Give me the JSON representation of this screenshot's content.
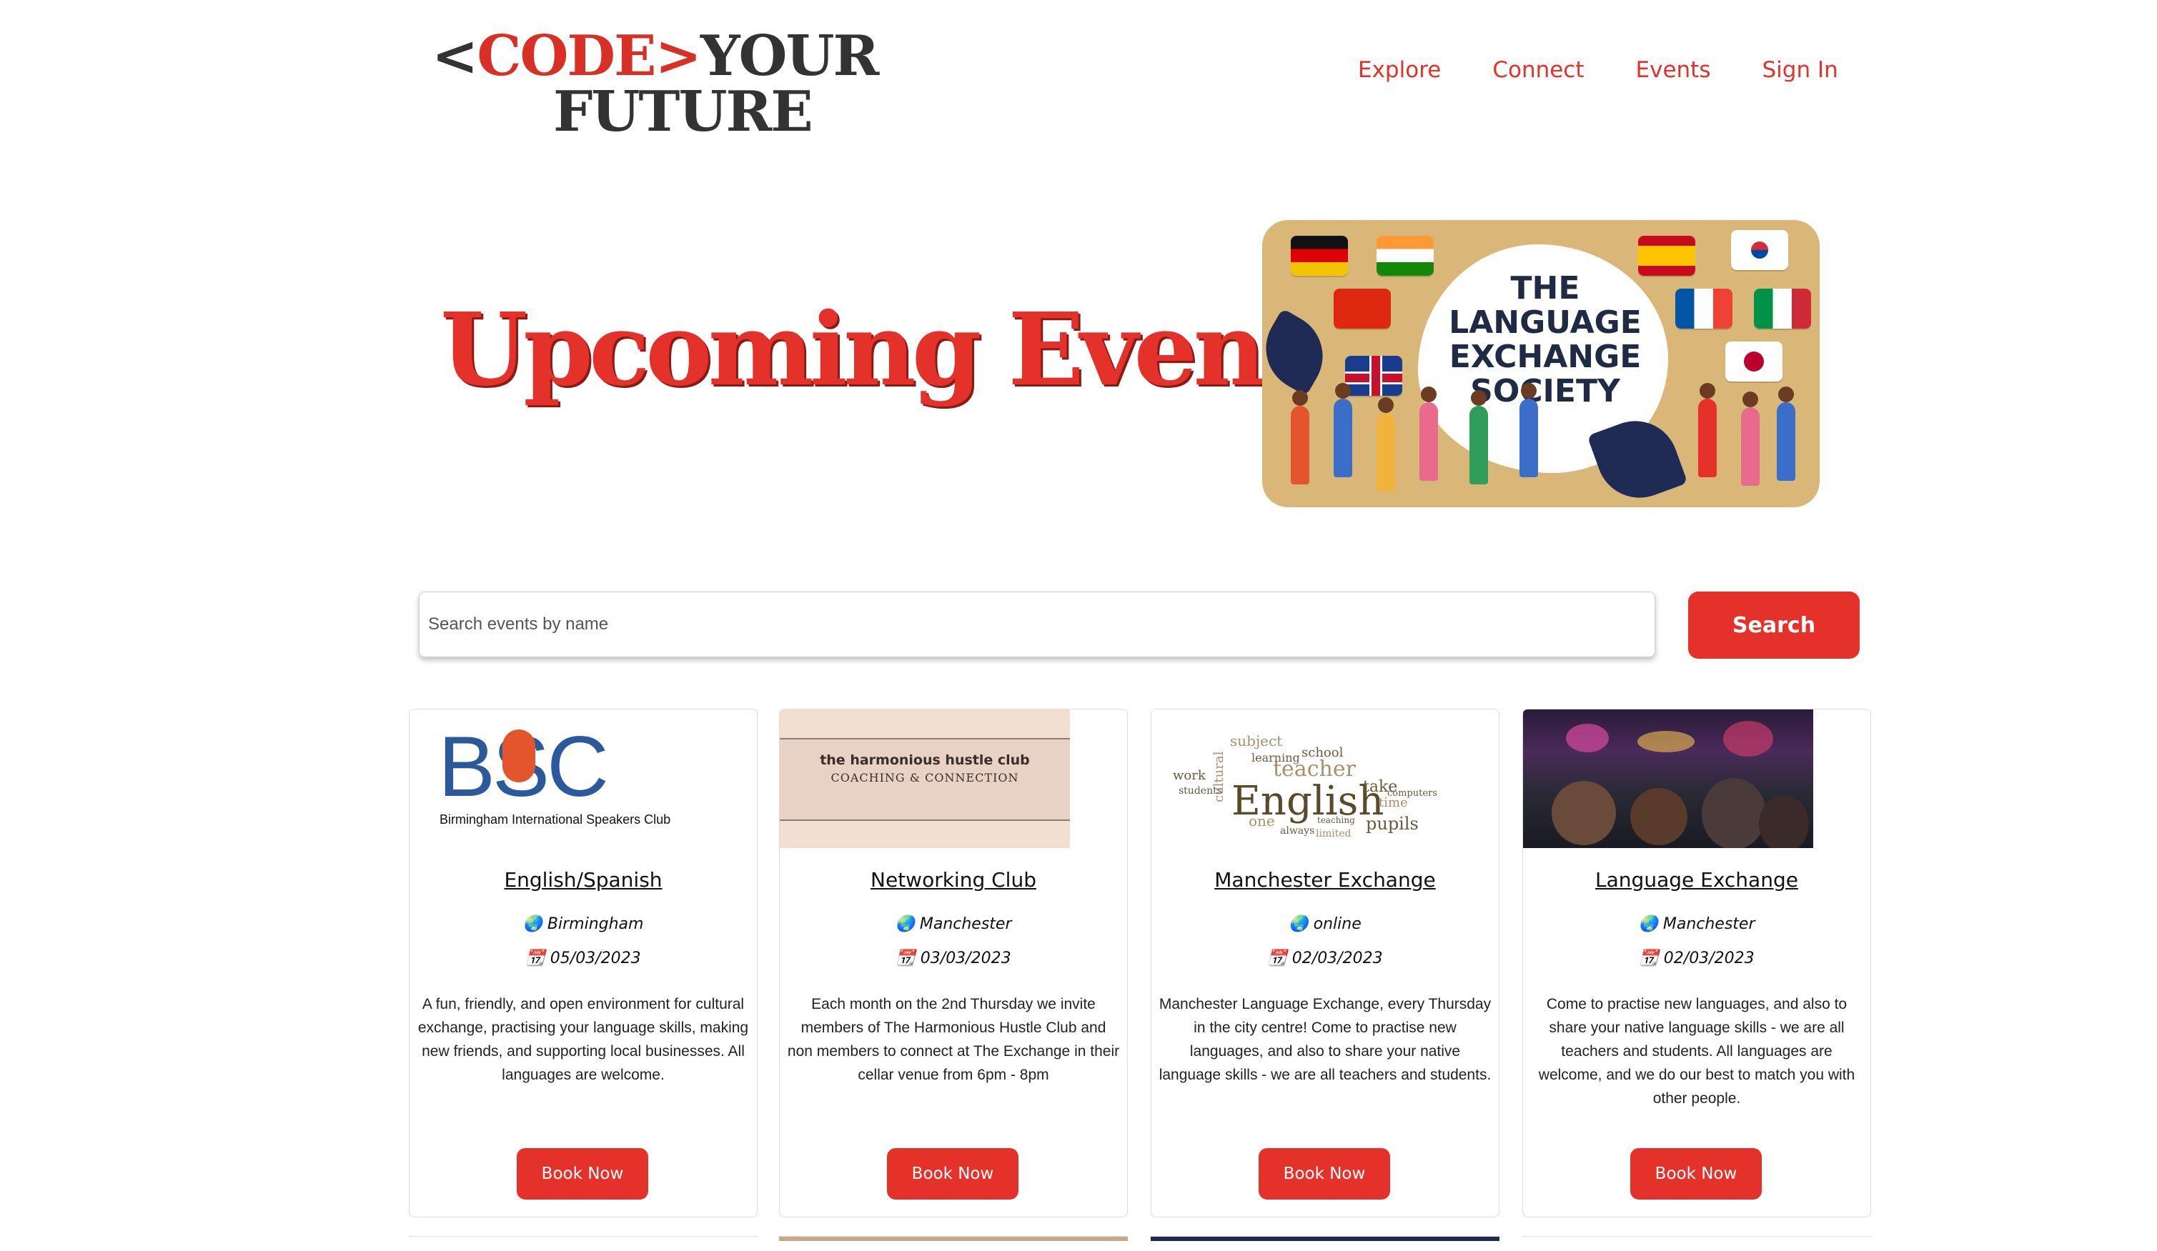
{
  "header": {
    "logo": {
      "line1_bracket_open": "<",
      "line1_code": "CODE",
      "line1_bracket_close": ">",
      "line1_your": "YOUR",
      "line2": "FUTURE"
    },
    "nav": [
      "Explore",
      "Connect",
      "Events",
      "Sign In"
    ]
  },
  "hero": {
    "title": "Upcoming Events",
    "image_text": [
      "THE",
      "LANGUAGE",
      "EXCHANGE",
      "SOCIETY"
    ]
  },
  "search": {
    "placeholder": "Search events by name",
    "button": "Search"
  },
  "events": [
    {
      "title": "English/Spanish",
      "location": "Birmingham",
      "date": "05/03/2023",
      "description": "A fun, friendly, and open environment for cultural exchange, practising your language skills, making new friends, and supporting local businesses. All languages are welcome.",
      "button": "Book Now",
      "image": {
        "logo_text": "BSC",
        "subtitle": "Birmingham International Speakers Club"
      }
    },
    {
      "title": "Networking Club",
      "location": "Manchester",
      "date": "03/03/2023",
      "description": "Each month on the 2nd Thursday we invite members of The Harmonious Hustle Club and non members to connect at The Exchange in their cellar venue from 6pm - 8pm",
      "button": "Book Now",
      "image": {
        "line1": "the harmonious hustle club",
        "line2": "COACHING & CONNECTION"
      }
    },
    {
      "title": "Manchester Exchange",
      "location": "online",
      "date": "02/03/2023",
      "description": "Manchester Language Exchange, every Thursday in the city centre! Come to practise new languages, and also to share your native language skills - we are all teachers and students.",
      "button": "Book Now",
      "image": {
        "words": [
          "English",
          "teacher",
          "pupils",
          "learning",
          "school",
          "subject",
          "cultural",
          "students",
          "work",
          "one",
          "always",
          "time",
          "take",
          "computers",
          "teaching",
          "limited"
        ]
      }
    },
    {
      "title": "Language Exchange",
      "location": "Manchester",
      "date": "02/03/2023",
      "description": "Come to practise new languages, and also to share your native language skills - we are all teachers and students. All languages are welcome, and we do our best to match you with other people.",
      "button": "Book Now",
      "image": {}
    }
  ],
  "icons": {
    "location": "globe-icon",
    "date": "calendar-icon"
  },
  "colors": {
    "accent": "#e4322b",
    "logo_dark": "#333333",
    "bisc_blue": "#2a5a9c"
  }
}
